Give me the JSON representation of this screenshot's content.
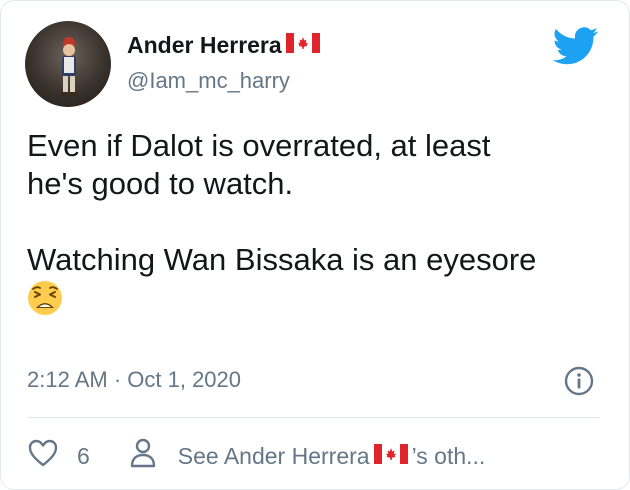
{
  "tweet": {
    "display_name": "Ander Herrera",
    "name_flag_icon": "canada-flag-icon",
    "handle": "@Iam_mc_harry",
    "platform_icon": "twitter-bird-icon",
    "text_line1": "Even if Dalot is overrated, at least",
    "text_line2": "he's good to watch.",
    "text_line3": "Watching Wan Bissaka is an eyesore",
    "emoji": "weary-face-emoji",
    "timestamp": "2:12 AM · Oct 1, 2020",
    "info_icon": "info-icon"
  },
  "actions": {
    "like_icon": "heart-icon",
    "like_count": "6",
    "profile_icon": "person-icon",
    "see_more_prefix": "See Ander Herrera",
    "see_more_suffix": "’s oth..."
  },
  "colors": {
    "twitter_blue": "#1DA1F2",
    "text_primary": "#14171A",
    "text_secondary": "#657786",
    "flag_red": "#E0242B"
  }
}
